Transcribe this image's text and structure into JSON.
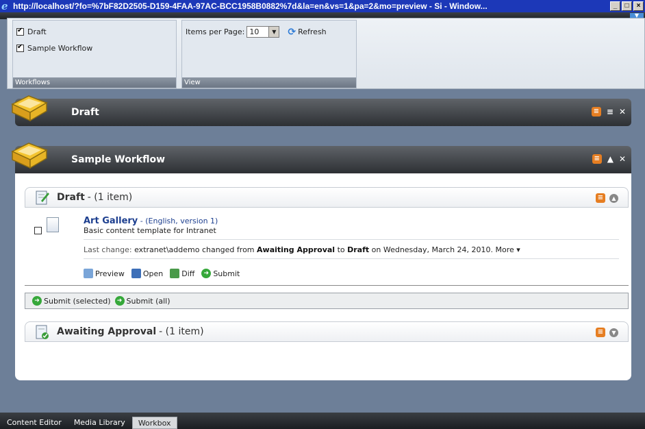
{
  "window": {
    "title": "http://localhost/?fo=%7bF82D2505-D159-4FAA-97AC-BCC1958B0882%7d&la=en&vs=1&pa=2&mo=preview - Si - Window...",
    "buttons": [
      "_",
      "□",
      "×"
    ]
  },
  "ribbon": {
    "workflows": {
      "label": "Workflows",
      "items": [
        {
          "label": "Draft",
          "checked": true
        },
        {
          "label": "Sample Workflow",
          "checked": true
        }
      ]
    },
    "view": {
      "label": "View",
      "items_per_page_label": "Items per Page:",
      "items_per_page_value": "10",
      "refresh_label": "Refresh"
    }
  },
  "panels": {
    "draft": {
      "title": "Draft"
    },
    "sample": {
      "title": "Sample Workflow",
      "sections": {
        "draft": {
          "title": "Draft",
          "count": "- (1 item)",
          "item": {
            "title": "Art Gallery",
            "meta": "- (English, version 1)",
            "desc": "Basic content template for Intranet",
            "last_change_label": "Last change:",
            "user": "extranet\\addemo",
            "changed_from": "changed from",
            "from_state": "Awaiting Approval",
            "to": "to",
            "to_state": "Draft",
            "on": "on Wednesday, March 24, 2010.",
            "more": "More ▾"
          },
          "actions": {
            "preview": "Preview",
            "open": "Open",
            "diff": "Diff",
            "submit": "Submit"
          },
          "bulk": {
            "submit_selected": "Submit (selected)",
            "submit_all": "Submit (all)"
          }
        },
        "awaiting": {
          "title": "Awaiting Approval",
          "count": "- (1 item)"
        }
      }
    }
  },
  "taskbar": {
    "tabs": [
      "Content Editor",
      "Media Library",
      "Workbox"
    ]
  },
  "colors": {
    "accent": "#1d3f8f",
    "rss": "#e67e22",
    "go": "#36a83a"
  }
}
